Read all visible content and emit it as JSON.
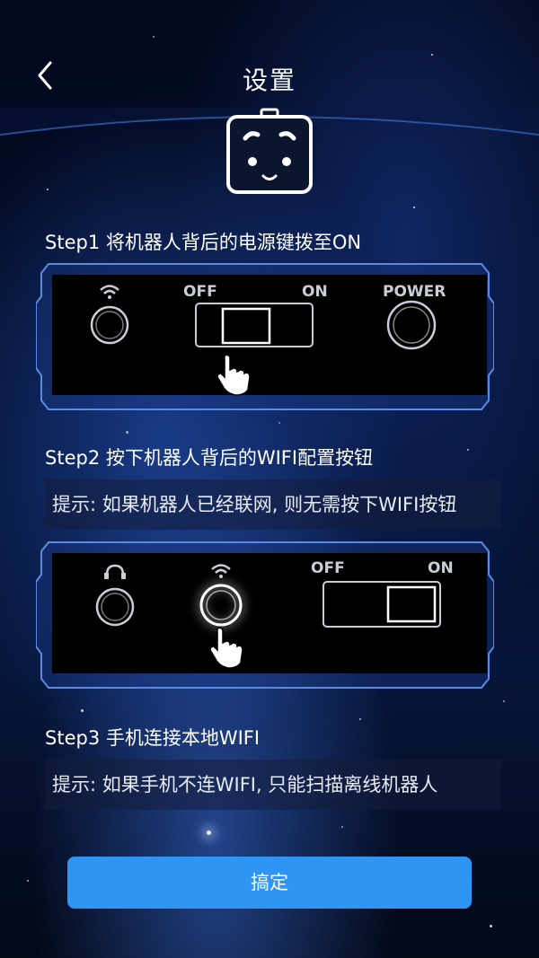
{
  "header": {
    "title": "设置",
    "back_icon": "chevron-left-icon"
  },
  "robot_icon": "robot-face-icon",
  "step1": {
    "label": "Step1 将机器人背后的电源键拨至ON",
    "panel": {
      "off_label": "OFF",
      "on_label": "ON",
      "power_label": "POWER"
    }
  },
  "step2": {
    "label": "Step2 按下机器人背后的WIFI配置按钮",
    "hint": "提示: 如果机器人已经联网, 则无需按下WIFI按钮",
    "panel": {
      "off_label": "OFF",
      "on_label": "ON"
    }
  },
  "step3": {
    "label": "Step3 手机连接本地WIFI",
    "hint": "提示: 如果手机不连WIFI, 只能扫描离线机器人"
  },
  "confirm": {
    "label": "搞定"
  },
  "colors": {
    "accent": "#2f95f5",
    "panel_border": "#5a8be0",
    "panel_bg": "#000000"
  }
}
